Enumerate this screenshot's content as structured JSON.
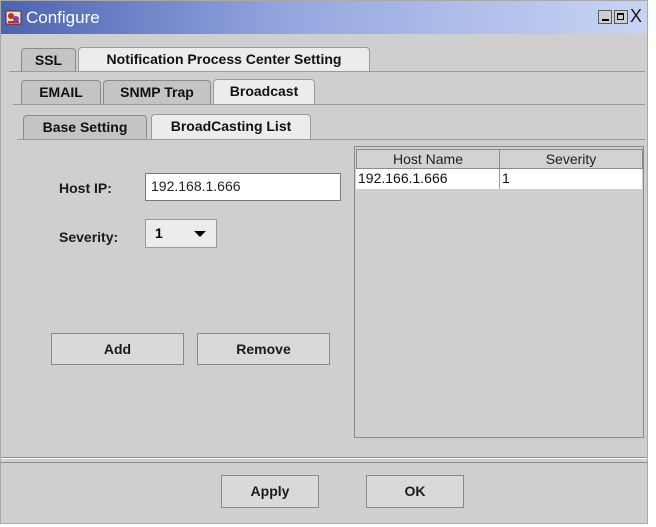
{
  "window": {
    "title": "Configure",
    "close_glyph": "X"
  },
  "tabs_top": [
    "SSL",
    "Notification Process Center Setting"
  ],
  "tabs_mid": [
    "EMAIL",
    "SNMP Trap",
    "Broadcast"
  ],
  "tabs_inner": [
    "Base Setting",
    "BroadCasting List"
  ],
  "form": {
    "host_ip_label": "Host IP:",
    "host_ip_value": "192.168.1.666",
    "severity_label": "Severity:",
    "severity_value": "1",
    "add_label": "Add",
    "remove_label": "Remove"
  },
  "table": {
    "headers": [
      "Host Name",
      "Severity"
    ],
    "rows": [
      {
        "host": "192.166.1.666",
        "severity": "1"
      }
    ]
  },
  "footer": {
    "apply_label": "Apply",
    "ok_label": "OK"
  }
}
